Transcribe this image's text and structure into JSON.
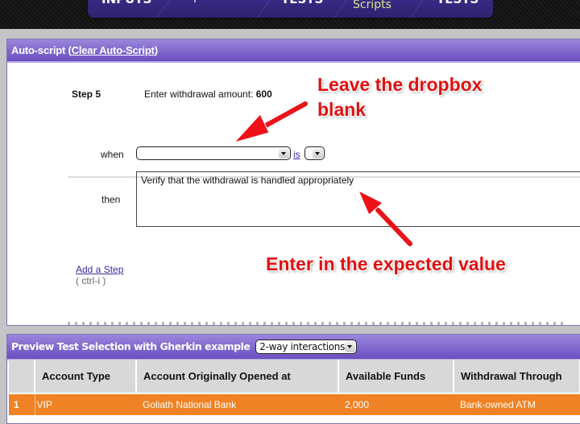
{
  "nav": {
    "tabs": [
      {
        "label": "INPUTS",
        "active": false
      },
      {
        "label": "Requirements",
        "active": false
      },
      {
        "label": "TESTS",
        "active": false
      },
      {
        "label": "Scripts",
        "active": true
      },
      {
        "label": "TESTS",
        "active": false
      }
    ],
    "active_color": "#d8e68a"
  },
  "autoscript": {
    "title_prefix": "Auto-script (",
    "clear_link": "Clear Auto-Script",
    "title_suffix": ")",
    "step_label": "Step 5",
    "step_text": "Enter withdrawal amount: ",
    "step_value": "600",
    "when_label": "when",
    "when_select_value": "",
    "is_link": "is",
    "is_select_value": "",
    "then_label": "then",
    "then_value": "Verify that the withdrawal is handled appropriately",
    "add_step_link": "Add a Step",
    "add_step_shortcut": "( ctrl-i )"
  },
  "annotations": {
    "top_line1": "Leave the dropbox",
    "top_line2": "blank",
    "bottom": "Enter in the expected value",
    "color": "#e01010"
  },
  "preview": {
    "title": "Preview Test Selection with Gherkin example",
    "interaction_select_value": "2-way interactions",
    "columns": [
      "",
      "Account Type",
      "Account Originally Opened at",
      "Available Funds",
      "Withdrawal Through"
    ],
    "rows": [
      {
        "num": "1",
        "account_type": "VIP",
        "opened_at": "Goliath National Bank",
        "funds": "2,000",
        "withdrawal": "Bank-owned ATM"
      }
    ],
    "row_highlight_color": "#ef8224"
  }
}
